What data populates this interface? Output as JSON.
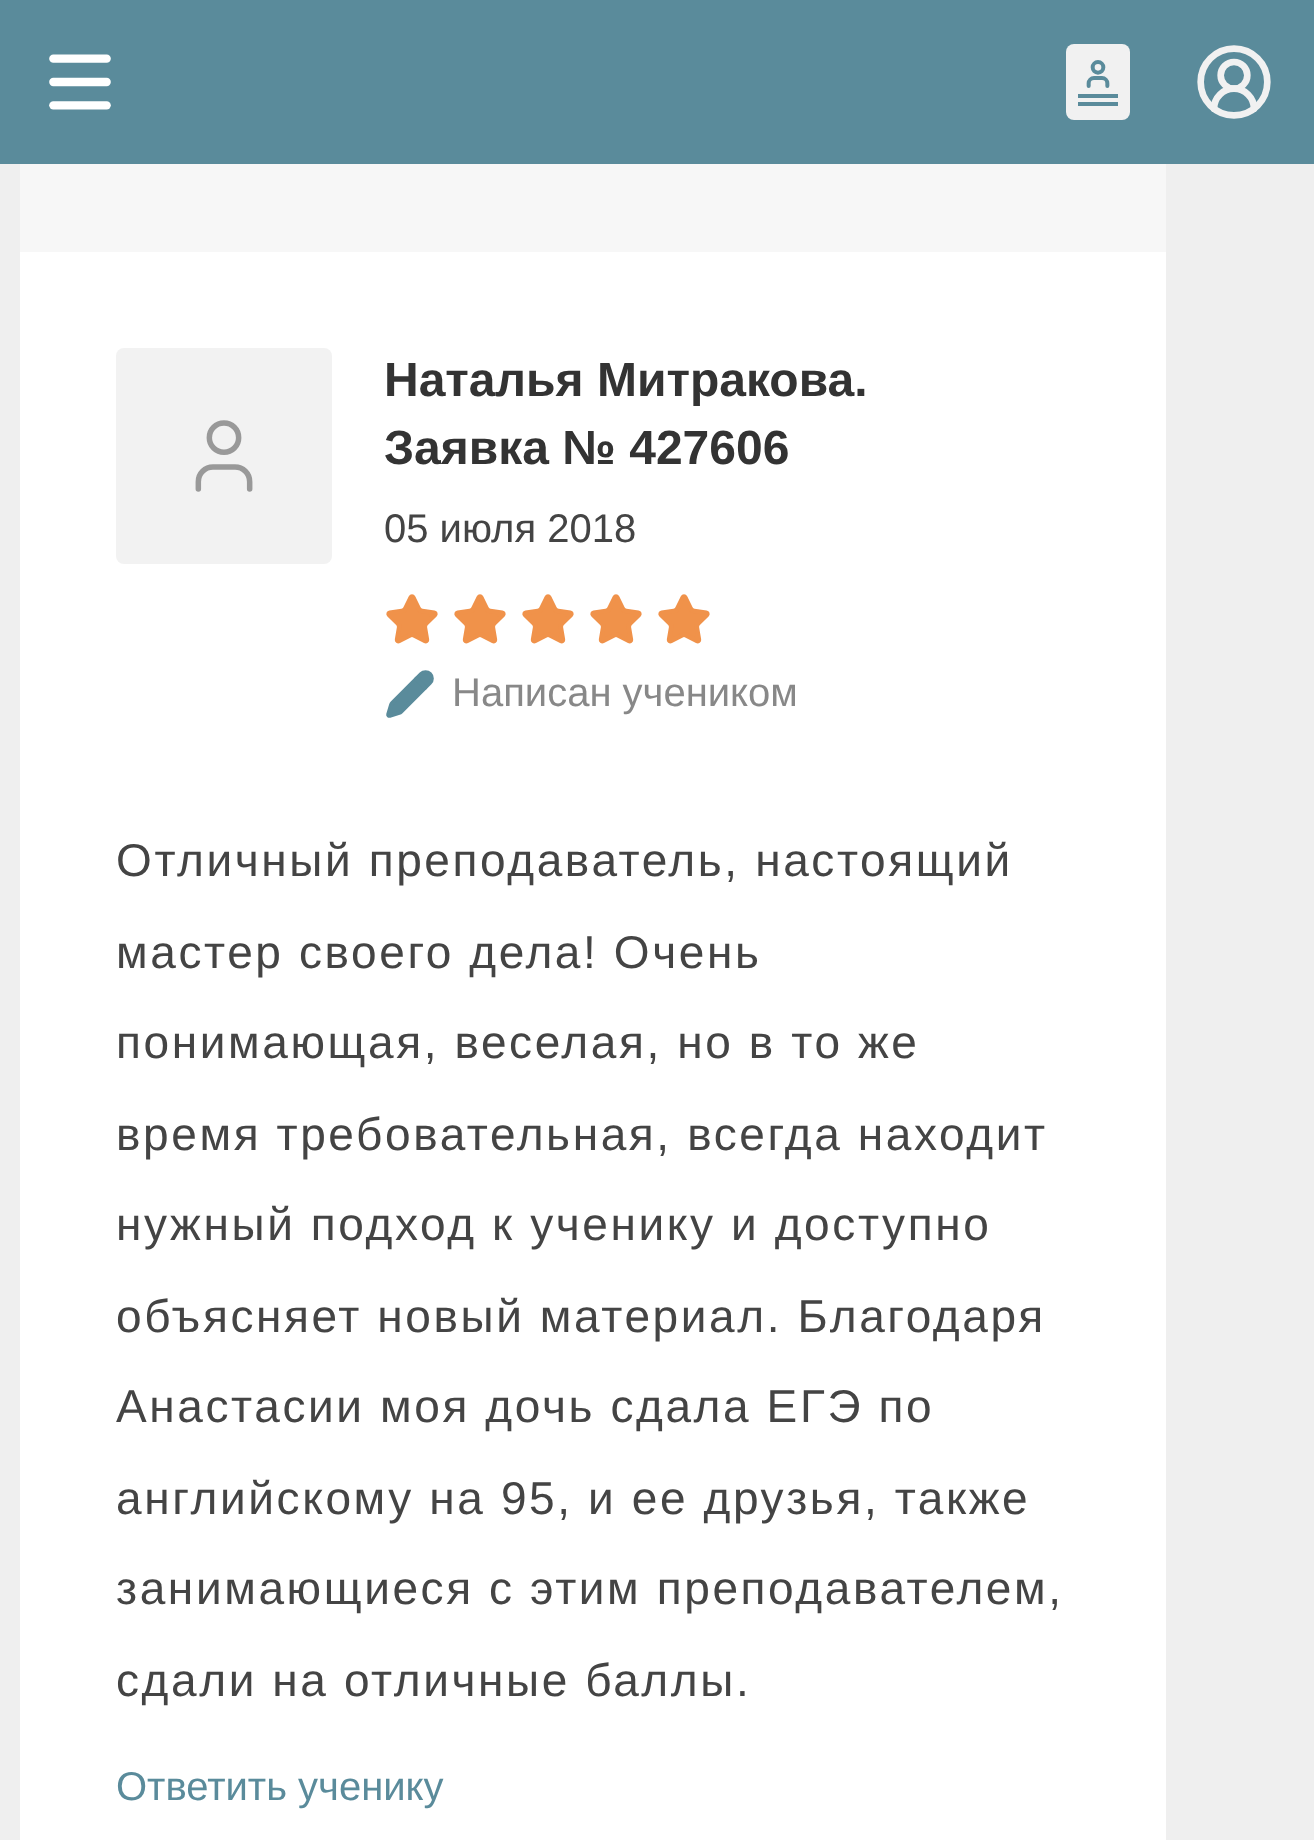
{
  "review": {
    "author": "Наталья Митракова.",
    "request": "Заявка № 427606",
    "date": "05 июля 2018",
    "stars": 5,
    "source": "Написан учеником",
    "text": "Отличный преподаватель, настоящий мастер своего дела! Очень понимающая, веселая, но в то же время требовательная, всегда находит нужный подход к ученику и доступно объясняет новый материал. Благодаря Анастасии моя дочь сдала ЕГЭ по английскому на 95, и ее друзья, также занимающиеся с этим преподавателем, сдали на отличные баллы.",
    "reply_link": "Ответить ученику"
  }
}
